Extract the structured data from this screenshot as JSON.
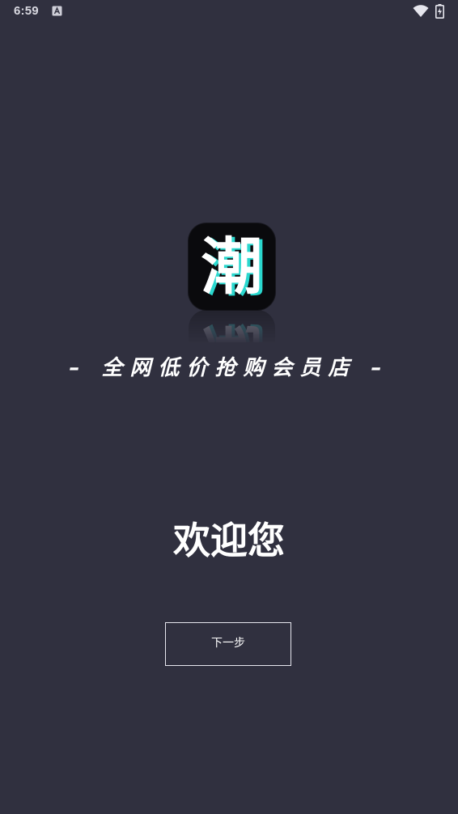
{
  "status_bar": {
    "time": "6:59",
    "icons": [
      "notification-a-icon",
      "wifi-icon",
      "battery-icon"
    ]
  },
  "logo": {
    "character": "潮",
    "accent_color": "#2ad8cf",
    "background_color": "#0a0a0d"
  },
  "tagline": "– 全网低价抢购会员店 –",
  "welcome": {
    "title": "欢迎您"
  },
  "actions": {
    "next_label": "下一步"
  },
  "theme": {
    "background": "#30303f",
    "text": "#ffffff"
  }
}
